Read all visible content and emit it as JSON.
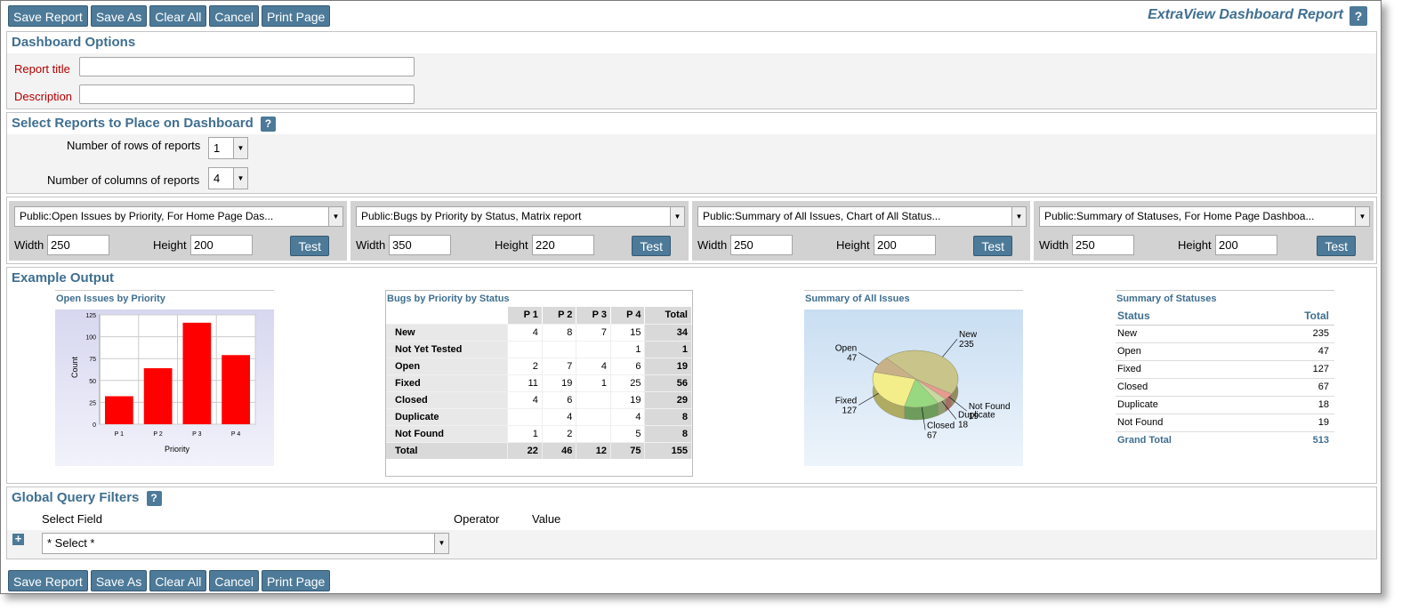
{
  "toolbar": {
    "buttons": [
      "Save Report",
      "Save As",
      "Clear All",
      "Cancel",
      "Print Page"
    ]
  },
  "app_title": "ExtraView Dashboard Report",
  "help_label": "?",
  "dashboard_options": {
    "title": "Dashboard Options",
    "report_title_label": "Report title",
    "report_title_value": "",
    "description_label": "Description",
    "description_value": ""
  },
  "select_reports": {
    "title": "Select Reports to Place on Dashboard",
    "rows_label": "Number of rows of reports",
    "rows_value": "1",
    "cols_label": "Number of columns of reports",
    "cols_value": "4"
  },
  "report_panels": [
    {
      "report": "Public:Open Issues by Priority, For Home Page Das...",
      "width_label": "Width",
      "width": "250",
      "height_label": "Height",
      "height": "200",
      "test_label": "Test"
    },
    {
      "report": "Public:Bugs by Priority by Status, Matrix report",
      "width_label": "Width",
      "width": "350",
      "height_label": "Height",
      "height": "220",
      "test_label": "Test"
    },
    {
      "report": "Public:Summary of All Issues, Chart of All Status...",
      "width_label": "Width",
      "width": "250",
      "height_label": "Height",
      "height": "200",
      "test_label": "Test"
    },
    {
      "report": "Public:Summary of Statuses, For Home Page Dashboa...",
      "width_label": "Width",
      "width": "250",
      "height_label": "Height",
      "height": "200",
      "test_label": "Test"
    }
  ],
  "example_output": {
    "title": "Example Output"
  },
  "chart_data": [
    {
      "type": "bar",
      "title": "Open Issues by Priority",
      "categories": [
        "P 1",
        "P 2",
        "P 3",
        "P 4"
      ],
      "values": [
        32,
        64,
        116,
        79
      ],
      "xlabel": "Priority",
      "ylabel": "Count",
      "ylim": [
        0,
        125
      ],
      "yticks": [
        "0",
        "25",
        "50",
        "75",
        "100",
        "125"
      ],
      "grid": true,
      "bar_color": "#ff0000"
    },
    {
      "type": "table",
      "title": "Bugs by Priority by Status",
      "columns": [
        "",
        "P 1",
        "P 2",
        "P 3",
        "P 4",
        "Total"
      ],
      "rows": [
        [
          "New",
          "4",
          "8",
          "7",
          "15",
          "34"
        ],
        [
          "Not Yet Tested",
          "",
          "",
          "",
          "1",
          "1"
        ],
        [
          "Open",
          "2",
          "7",
          "4",
          "6",
          "19"
        ],
        [
          "Fixed",
          "11",
          "19",
          "1",
          "25",
          "56"
        ],
        [
          "Closed",
          "4",
          "6",
          "",
          "19",
          "29"
        ],
        [
          "Duplicate",
          "",
          "4",
          "",
          "4",
          "8"
        ],
        [
          "Not Found",
          "1",
          "2",
          "",
          "5",
          "8"
        ],
        [
          "Total",
          "22",
          "46",
          "12",
          "75",
          "155"
        ]
      ]
    },
    {
      "type": "pie",
      "title": "Summary of All Issues",
      "slices": [
        {
          "label": "New",
          "value": 235,
          "color": "#c9c48a"
        },
        {
          "label": "Not Found",
          "value": 19,
          "color": "#e89a90"
        },
        {
          "label": "Duplicate",
          "value": 18,
          "color": "#c8d8a0"
        },
        {
          "label": "Closed",
          "value": 67,
          "color": "#98d880"
        },
        {
          "label": "Fixed",
          "value": 127,
          "color": "#f4ee8a"
        },
        {
          "label": "Open",
          "value": 47,
          "color": "#c8b088"
        }
      ]
    },
    {
      "type": "table",
      "title": "Summary of Statuses",
      "columns": [
        "Status",
        "Total"
      ],
      "rows": [
        [
          "New",
          "235"
        ],
        [
          "Open",
          "47"
        ],
        [
          "Fixed",
          "127"
        ],
        [
          "Closed",
          "67"
        ],
        [
          "Duplicate",
          "18"
        ],
        [
          "Not Found",
          "19"
        ]
      ],
      "grand_total_label": "Grand Total",
      "grand_total": "513"
    }
  ],
  "global_filters": {
    "title": "Global Query Filters",
    "select_field_label": "Select Field",
    "operator_label": "Operator",
    "value_label": "Value",
    "select_value": "* Select *",
    "add_icon": "plus-icon"
  },
  "colors": {
    "button_bg": "#4d7a98",
    "section_title": "#3f6f90",
    "label_red": "#b00000"
  }
}
